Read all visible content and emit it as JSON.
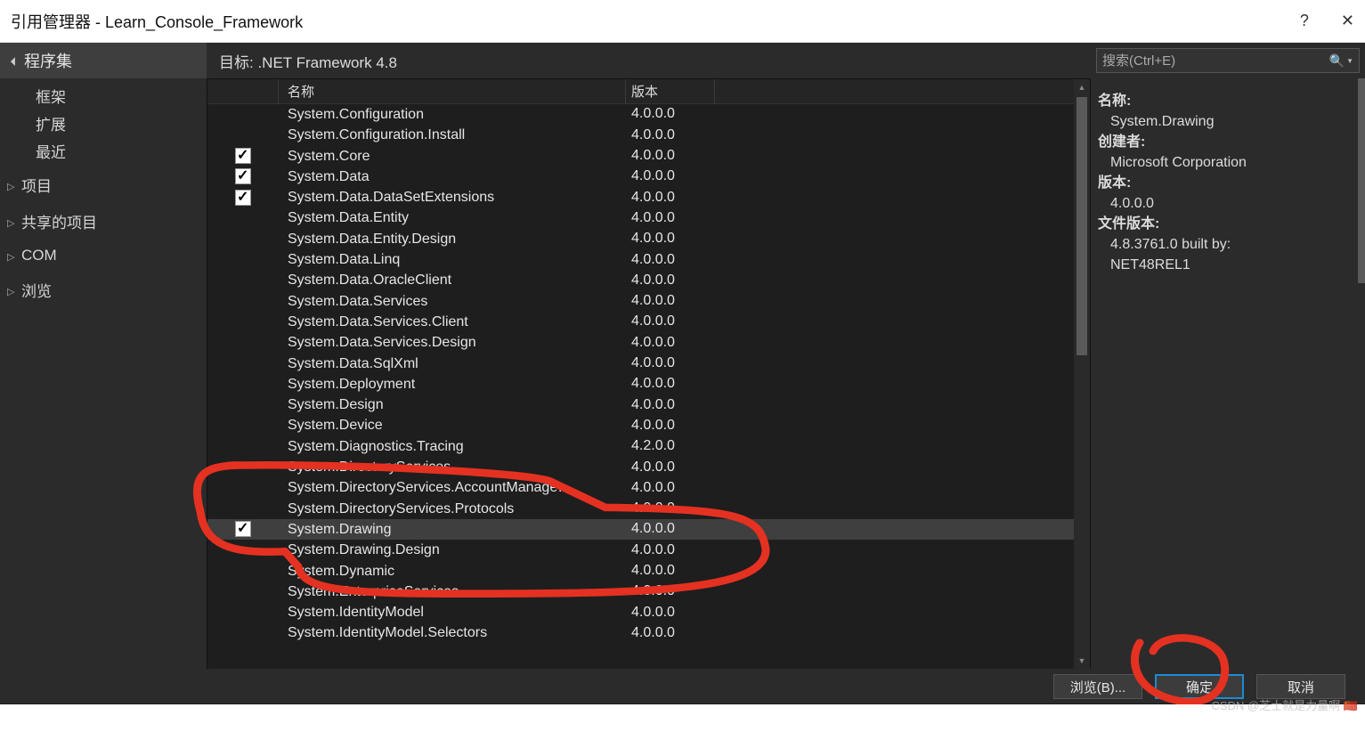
{
  "titlebar": {
    "title": "引用管理器 - Learn_Console_Framework",
    "help": "?",
    "close": "✕"
  },
  "header": {
    "category": "程序集",
    "target_label": "目标: .NET Framework 4.8"
  },
  "search": {
    "placeholder": "搜索(Ctrl+E)"
  },
  "sidebar": {
    "sub": [
      "框架",
      "扩展",
      "最近"
    ],
    "sections": [
      "项目",
      "共享的项目",
      "COM",
      "浏览"
    ]
  },
  "columns": {
    "name": "名称",
    "version": "版本"
  },
  "rows": [
    {
      "name": "System.Configuration",
      "version": "4.0.0.0",
      "checked": false,
      "selected": false
    },
    {
      "name": "System.Configuration.Install",
      "version": "4.0.0.0",
      "checked": false,
      "selected": false
    },
    {
      "name": "System.Core",
      "version": "4.0.0.0",
      "checked": true,
      "selected": false
    },
    {
      "name": "System.Data",
      "version": "4.0.0.0",
      "checked": true,
      "selected": false
    },
    {
      "name": "System.Data.DataSetExtensions",
      "version": "4.0.0.0",
      "checked": true,
      "selected": false
    },
    {
      "name": "System.Data.Entity",
      "version": "4.0.0.0",
      "checked": false,
      "selected": false
    },
    {
      "name": "System.Data.Entity.Design",
      "version": "4.0.0.0",
      "checked": false,
      "selected": false
    },
    {
      "name": "System.Data.Linq",
      "version": "4.0.0.0",
      "checked": false,
      "selected": false
    },
    {
      "name": "System.Data.OracleClient",
      "version": "4.0.0.0",
      "checked": false,
      "selected": false
    },
    {
      "name": "System.Data.Services",
      "version": "4.0.0.0",
      "checked": false,
      "selected": false
    },
    {
      "name": "System.Data.Services.Client",
      "version": "4.0.0.0",
      "checked": false,
      "selected": false
    },
    {
      "name": "System.Data.Services.Design",
      "version": "4.0.0.0",
      "checked": false,
      "selected": false
    },
    {
      "name": "System.Data.SqlXml",
      "version": "4.0.0.0",
      "checked": false,
      "selected": false
    },
    {
      "name": "System.Deployment",
      "version": "4.0.0.0",
      "checked": false,
      "selected": false
    },
    {
      "name": "System.Design",
      "version": "4.0.0.0",
      "checked": false,
      "selected": false
    },
    {
      "name": "System.Device",
      "version": "4.0.0.0",
      "checked": false,
      "selected": false
    },
    {
      "name": "System.Diagnostics.Tracing",
      "version": "4.2.0.0",
      "checked": false,
      "selected": false
    },
    {
      "name": "System.DirectoryServices",
      "version": "4.0.0.0",
      "checked": false,
      "selected": false
    },
    {
      "name": "System.DirectoryServices.AccountManage…",
      "version": "4.0.0.0",
      "checked": false,
      "selected": false
    },
    {
      "name": "System.DirectoryServices.Protocols",
      "version": "4.0.0.0",
      "checked": false,
      "selected": false
    },
    {
      "name": "System.Drawing",
      "version": "4.0.0.0",
      "checked": true,
      "selected": true
    },
    {
      "name": "System.Drawing.Design",
      "version": "4.0.0.0",
      "checked": false,
      "selected": false
    },
    {
      "name": "System.Dynamic",
      "version": "4.0.0.0",
      "checked": false,
      "selected": false
    },
    {
      "name": "System.EnterpriseServices",
      "version": "4.0.0.0",
      "checked": false,
      "selected": false
    },
    {
      "name": "System.IdentityModel",
      "version": "4.0.0.0",
      "checked": false,
      "selected": false
    },
    {
      "name": "System.IdentityModel.Selectors",
      "version": "4.0.0.0",
      "checked": false,
      "selected": false
    }
  ],
  "details": {
    "name_label": "名称:",
    "name_value": "System.Drawing",
    "author_label": "创建者:",
    "author_value": "Microsoft Corporation",
    "version_label": "版本:",
    "version_value": "4.0.0.0",
    "filever_label": "文件版本:",
    "filever_value1": "4.8.3761.0 built by:",
    "filever_value2": "NET48REL1"
  },
  "footer": {
    "browse": "浏览(B)...",
    "ok": "确定",
    "cancel": "取消"
  },
  "watermark": "CSDN @芝士就是力量啊 🇨🇳"
}
